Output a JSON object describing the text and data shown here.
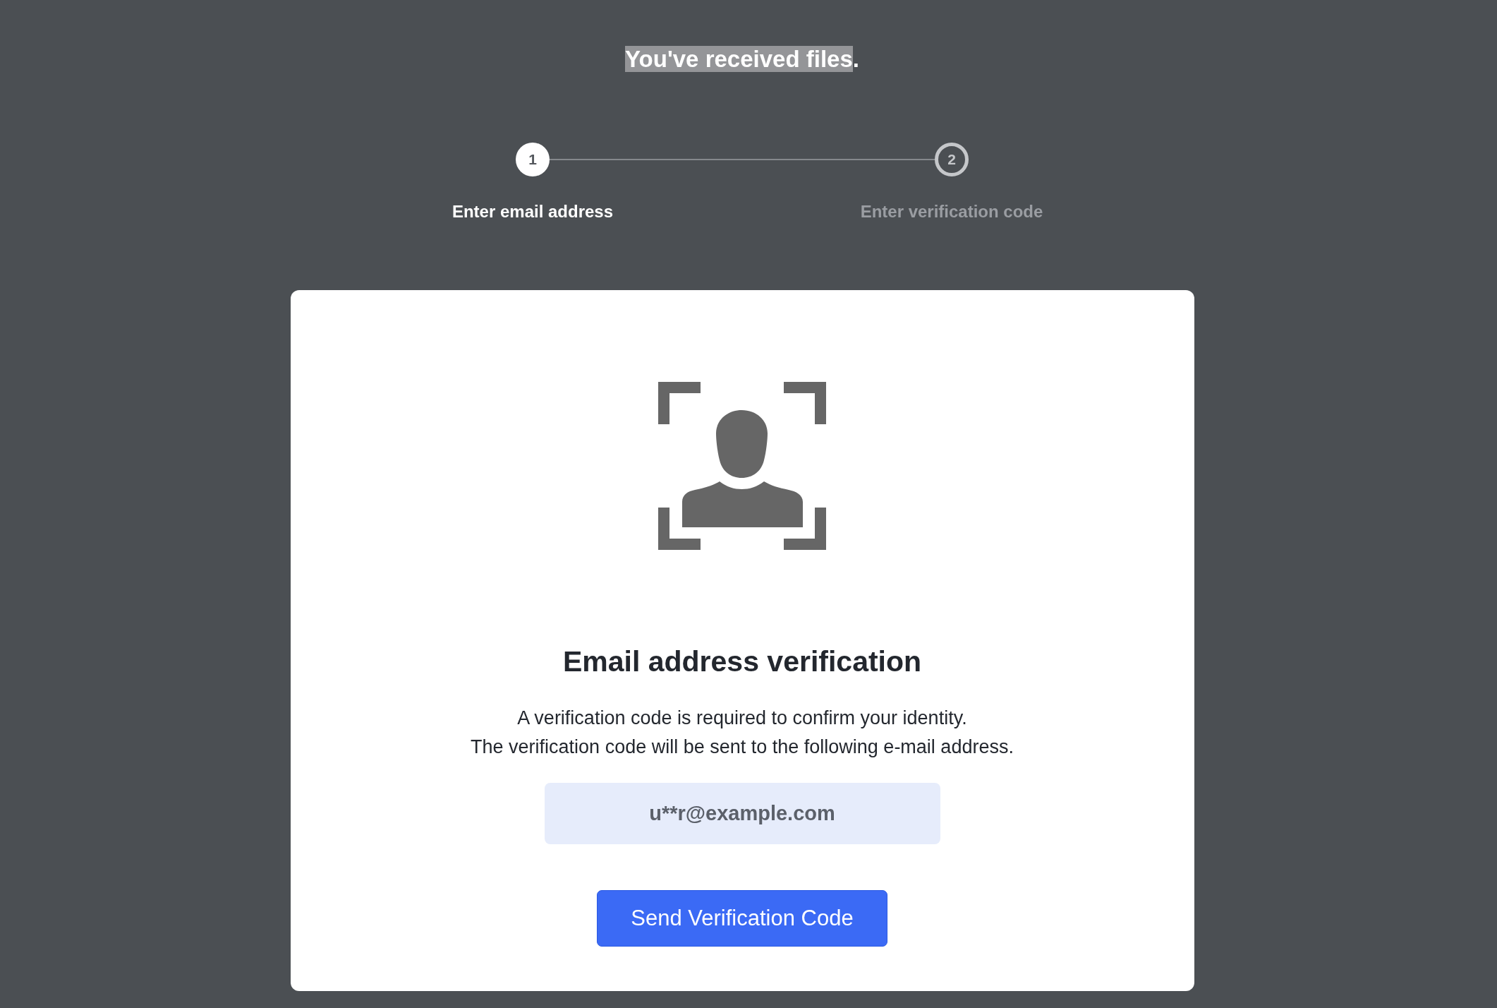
{
  "title": {
    "segments": [
      {
        "text": "You've received files",
        "selected": true
      },
      {
        "text": ".",
        "selected": false
      }
    ]
  },
  "steps": [
    {
      "number": "1",
      "label": "Enter email address",
      "selected": true
    },
    {
      "number": "2",
      "label": "Enter verification code",
      "selected": false
    }
  ],
  "card": {
    "heading": "Email address verification",
    "description": [
      "A verification code is required to confirm your identity.",
      "The verification code will be sent to the following e-mail address."
    ],
    "email_field": {
      "value": "u**r@example.com"
    },
    "send_button": {
      "label": "Send Verification Code"
    }
  }
}
